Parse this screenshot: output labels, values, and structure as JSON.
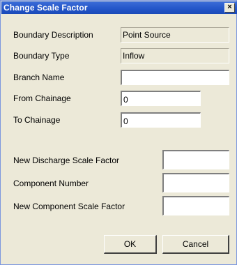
{
  "window": {
    "title": "Change Scale Factor",
    "close_glyph": "×"
  },
  "fields": {
    "boundary_description": {
      "label": "Boundary Description",
      "value": "Point Source"
    },
    "boundary_type": {
      "label": "Boundary Type",
      "value": "Inflow"
    },
    "branch_name": {
      "label": "Branch Name",
      "value": ""
    },
    "from_chainage": {
      "label": "From Chainage",
      "value": "0"
    },
    "to_chainage": {
      "label": "To Chainage",
      "value": "0"
    },
    "new_discharge_scale_factor": {
      "label": "New Discharge Scale Factor",
      "value": ""
    },
    "component_number": {
      "label": "Component Number",
      "value": ""
    },
    "new_component_scale_factor": {
      "label": "New Component Scale Factor",
      "value": ""
    }
  },
  "buttons": {
    "ok": "OK",
    "cancel": "Cancel"
  },
  "colors": {
    "dialog_background": "#ece9d8",
    "titlebar": "#2355c8",
    "title_text": "#ffffff"
  }
}
